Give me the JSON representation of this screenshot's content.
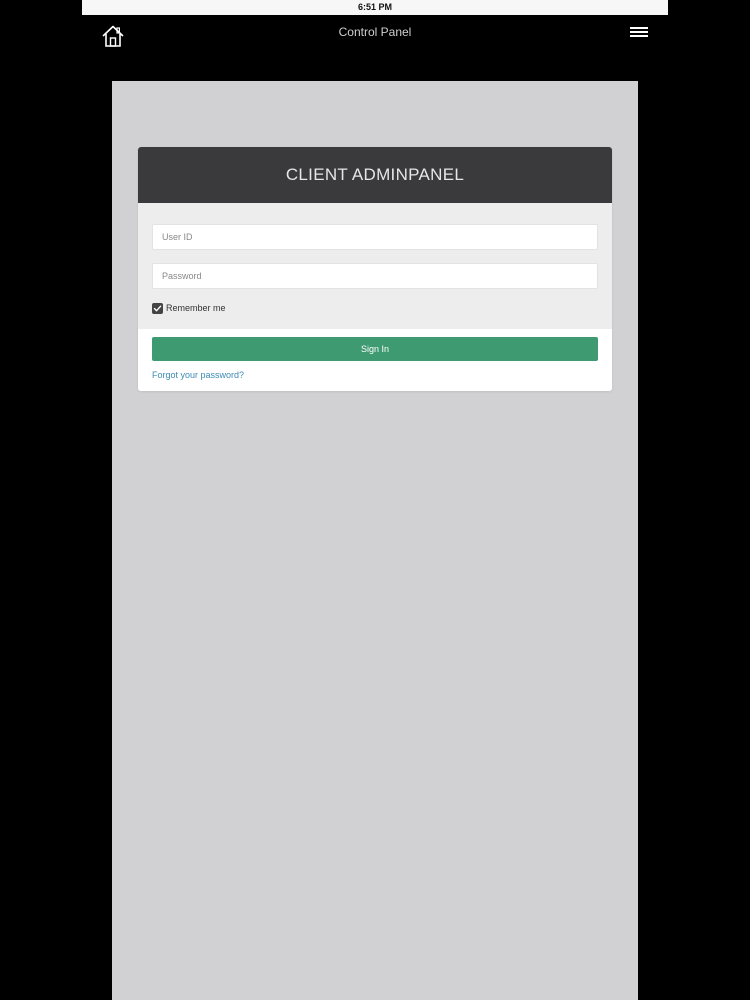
{
  "status_bar": {
    "time": "6:51 PM"
  },
  "nav": {
    "title": "Control Panel",
    "home_icon": "home-icon",
    "menu_icon": "hamburger-menu-icon"
  },
  "login": {
    "heading": "CLIENT ADMINPANEL",
    "user_id": {
      "placeholder": "User ID",
      "value": ""
    },
    "password": {
      "placeholder": "Password",
      "value": ""
    },
    "remember_me": {
      "label": "Remember me",
      "checked": true
    },
    "sign_in_label": "Sign In",
    "forgot_password_label": "Forgot your password?"
  },
  "colors": {
    "accent_green": "#3e9a70",
    "header_dark": "#3a393b",
    "link_blue": "#3c8ab5",
    "content_bg": "#d1d0d3"
  }
}
